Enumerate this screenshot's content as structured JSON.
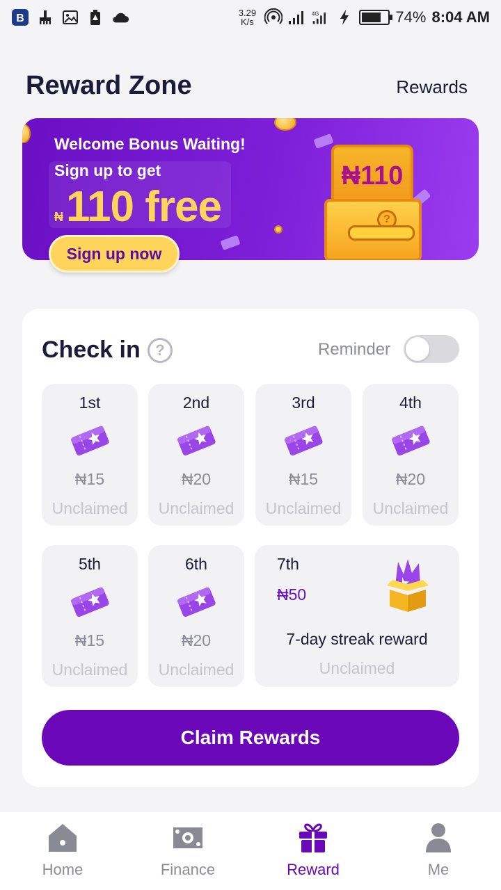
{
  "status_bar": {
    "speed_value": "3.29",
    "speed_unit": "K/s",
    "battery": "74%",
    "time": "8:04 AM",
    "battery_level": 0.74
  },
  "header": {
    "title": "Reward Zone",
    "rewards_link": "Rewards"
  },
  "banner": {
    "welcome": "Welcome Bonus Waiting!",
    "signup_line": "Sign up to get",
    "currency": "₦",
    "amount": "110 free",
    "chest_label": "₦110",
    "cta": "Sign up now"
  },
  "checkin": {
    "title": "Check in",
    "help": "?",
    "reminder_label": "Reminder",
    "reminder_on": false,
    "days": [
      {
        "label": "1st",
        "amount": "₦15",
        "status": "Unclaimed"
      },
      {
        "label": "2nd",
        "amount": "₦20",
        "status": "Unclaimed"
      },
      {
        "label": "3rd",
        "amount": "₦15",
        "status": "Unclaimed"
      },
      {
        "label": "4th",
        "amount": "₦20",
        "status": "Unclaimed"
      },
      {
        "label": "5th",
        "amount": "₦15",
        "status": "Unclaimed"
      },
      {
        "label": "6th",
        "amount": "₦20",
        "status": "Unclaimed"
      }
    ],
    "day7": {
      "label": "7th",
      "amount": "₦50",
      "description": "7-day streak reward",
      "status": "Unclaimed"
    },
    "claim_button": "Claim Rewards"
  },
  "bottom_nav": {
    "items": [
      {
        "label": "Home",
        "icon": "home-icon"
      },
      {
        "label": "Finance",
        "icon": "finance-icon"
      },
      {
        "label": "Reward",
        "icon": "gift-icon"
      },
      {
        "label": "Me",
        "icon": "person-icon"
      }
    ],
    "active": "Reward"
  },
  "colors": {
    "brand_purple": "#6a07b8",
    "banner_yellow": "#ffd45a",
    "background": "#f4f4f7"
  }
}
